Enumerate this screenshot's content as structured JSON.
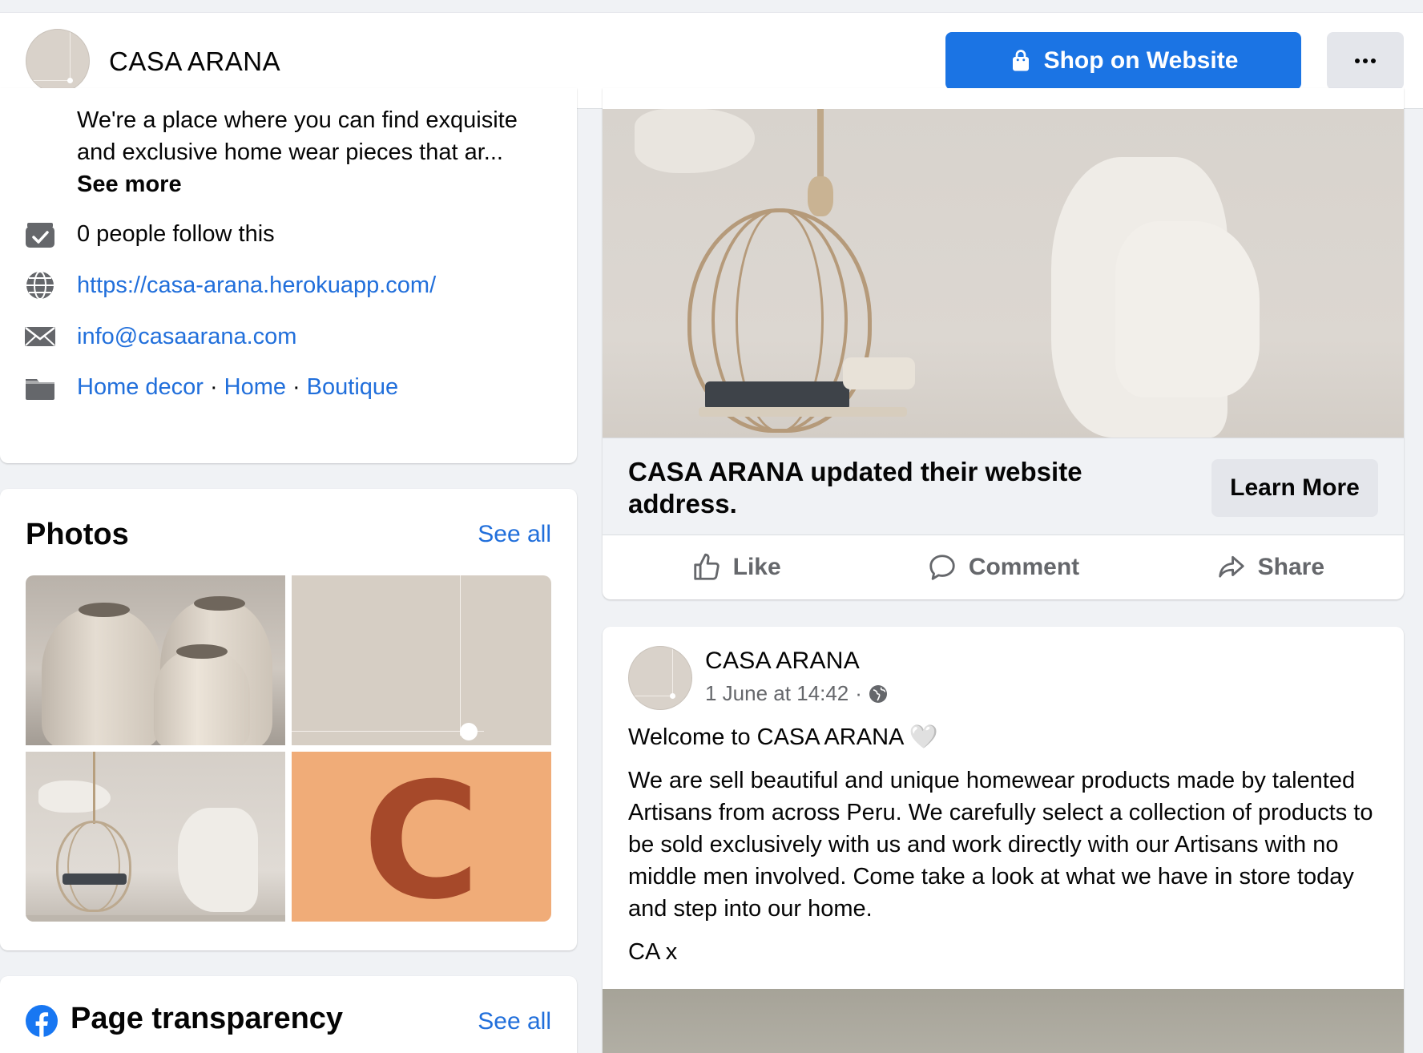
{
  "header": {
    "page_name": "CASA ARANA",
    "shop_button_label": "Shop on Website",
    "more_button_label": "···"
  },
  "intro": {
    "text": "We're a place where you can find exquisite and exclusive home wear pieces that ar...",
    "see_more": "See more",
    "followers": "0 people follow this",
    "website": "https://casa-arana.herokuapp.com/",
    "email": "info@casaarana.com",
    "categories": [
      "Home decor",
      "Home",
      "Boutique"
    ],
    "category_separator": "·"
  },
  "photos": {
    "title": "Photos",
    "see_all": "See all",
    "tile4_letter": "C"
  },
  "transparency": {
    "title": "Page transparency",
    "see_all": "See all"
  },
  "post1": {
    "link_title": "CASA ARANA updated their website address.",
    "learn_more": "Learn More",
    "actions": {
      "like": "Like",
      "comment": "Comment",
      "share": "Share"
    }
  },
  "post2": {
    "author": "CASA ARANA",
    "timestamp": "1 June at 14:42",
    "meta_separator": "·",
    "paragraphs": [
      "Welcome to CASA ARANA 🤍",
      "We are sell beautiful and unique homewear products made by talented Artisans from across Peru. We carefully select a collection of products to be sold exclusively with us and work directly with our Artisans with no middle men involved. Come take a look at what we have in store today and step into our home.",
      "CA x"
    ]
  },
  "colors": {
    "brand_blue": "#1b74e4",
    "link_blue": "#216fdb",
    "secondary_text": "#65676b",
    "button_gray": "#e4e6eb",
    "photo_orange": "#f0ac78",
    "photo_letter": "#a6492a"
  },
  "icons": {
    "shop": "shopping-bag-icon",
    "followers": "followers-check-icon",
    "website": "globe-icon",
    "email": "envelope-icon",
    "category": "folder-icon",
    "like": "thumbs-up-icon",
    "comment": "comment-bubble-icon",
    "share": "share-arrow-icon",
    "privacy": "globe-icon",
    "facebook": "facebook-logo-icon"
  }
}
